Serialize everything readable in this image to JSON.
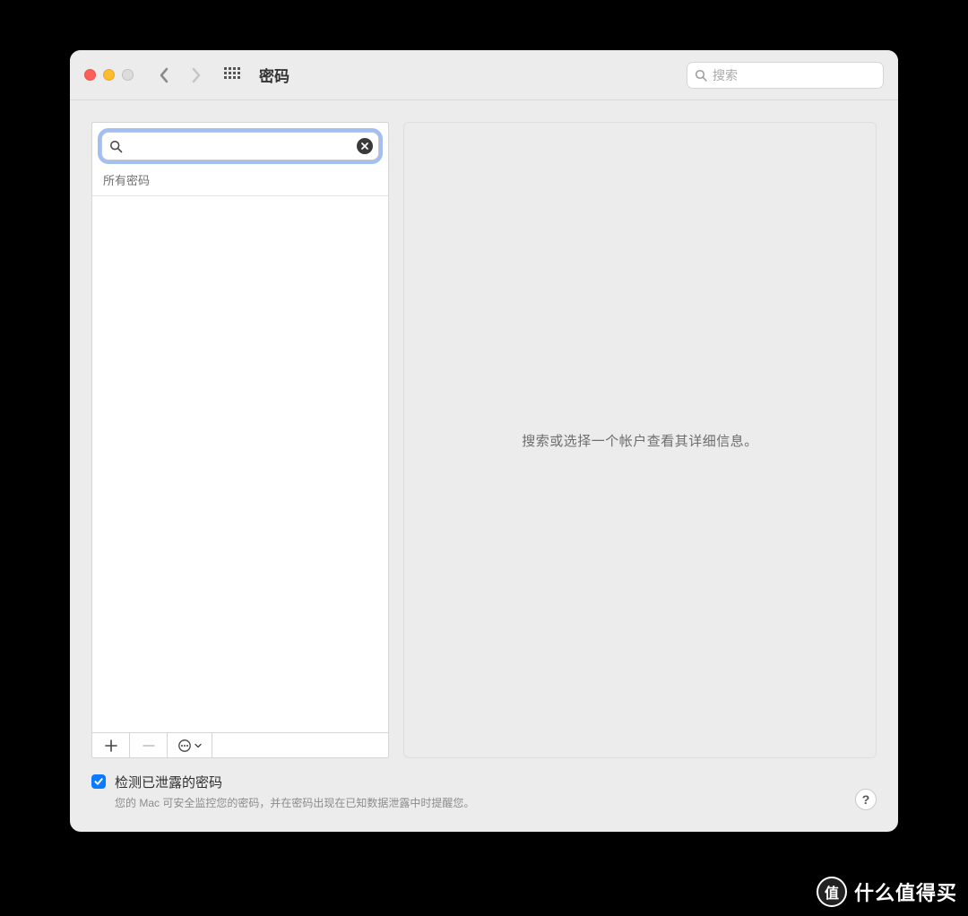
{
  "window": {
    "title": "密码"
  },
  "toolbar": {
    "search_placeholder": "搜索"
  },
  "sidebar": {
    "search_value": "",
    "section_label": "所有密码"
  },
  "detail": {
    "placeholder": "搜索或选择一个帐户查看其详细信息。"
  },
  "leak_check": {
    "checked": true,
    "label": "检测已泄露的密码",
    "description": "您的 Mac 可安全监控您的密码，并在密码出现在已知数据泄露中时提醒您。"
  },
  "help_label": "?",
  "watermark": {
    "badge": "值",
    "text": "什么值得买"
  }
}
